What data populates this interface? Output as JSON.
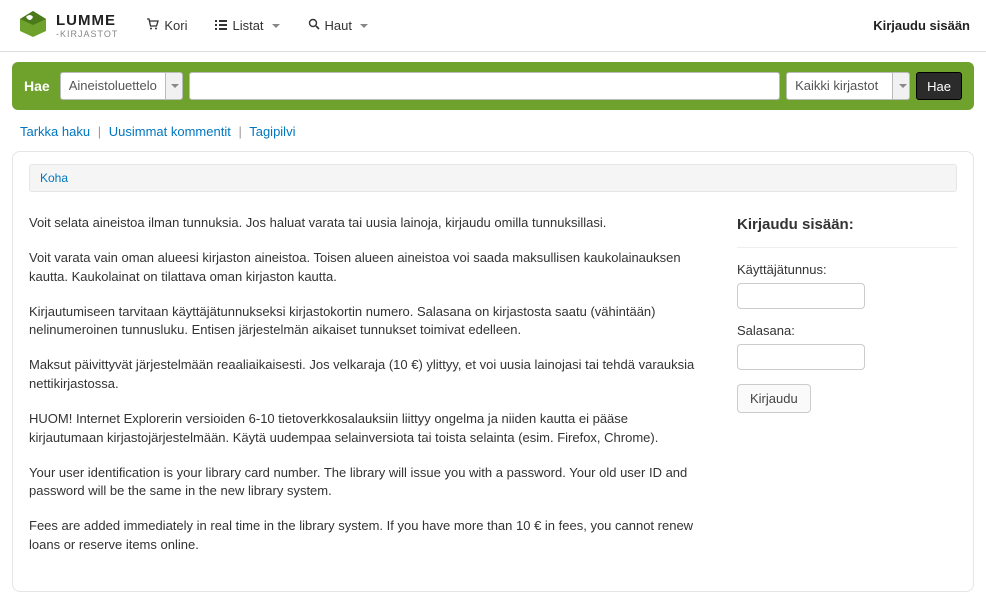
{
  "brand": {
    "name": "LUMME",
    "sub": "-KIRJASTOT"
  },
  "nav": {
    "cart": "Kori",
    "lists": "Listat",
    "searches": "Haut",
    "login": "Kirjaudu sisään"
  },
  "search": {
    "label": "Hae",
    "catalog_select": "Aineistoluettelo",
    "query": "",
    "library_select": "Kaikki kirjastot",
    "button": "Hae"
  },
  "sublinks": {
    "advanced": "Tarkka haku",
    "comments": "Uusimmat kommentit",
    "tagcloud": "Tagipilvi"
  },
  "breadcrumb": {
    "home": "Koha"
  },
  "content": {
    "p1": "Voit selata aineistoa ilman tunnuksia. Jos haluat varata tai uusia lainoja, kirjaudu omilla tunnuksillasi.",
    "p2": "Voit varata vain oman alueesi kirjaston aineistoa. Toisen alueen aineistoa voi saada maksullisen kaukolainauksen kautta. Kaukolainat on tilattava oman kirjaston kautta.",
    "p3": "Kirjautumiseen tarvitaan käyttäjätunnukseksi kirjastokortin numero. Salasana on kirjastosta saatu (vähintään) nelinumeroinen tunnusluku. Entisen järjestelmän aikaiset tunnukset toimivat edelleen.",
    "p4": "Maksut päivittyvät järjestelmään reaaliaikaisesti. Jos velkaraja (10 €) ylittyy, et voi uusia lainojasi tai tehdä varauksia nettikirjastossa.",
    "p5": "HUOM! Internet Explorerin versioiden 6-10 tietoverkkosalauksiin liittyy ongelma ja niiden kautta ei pääse kirjautumaan kirjastojärjestelmään. Käytä uudempaa selainversiota tai toista selainta (esim. Firefox, Chrome).",
    "p6": "Your user identification is your library card number. The library will issue you with a password. Your old user ID and password will be the same in the new library system.",
    "p7": "Fees are added immediately in real time in the library system. If you have more than 10 € in fees, you cannot renew loans or reserve items online."
  },
  "login_box": {
    "title": "Kirjaudu sisään:",
    "user_label": "Käyttäjätunnus:",
    "pass_label": "Salasana:",
    "button": "Kirjaudu"
  }
}
